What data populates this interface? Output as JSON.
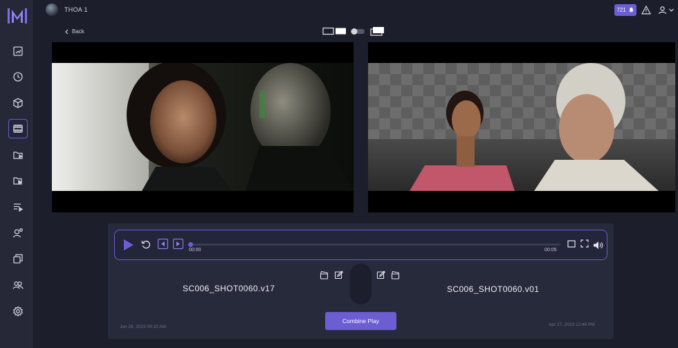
{
  "app": {
    "brand_icon": "m-logo-icon",
    "accent_color": "#6c5dd3"
  },
  "sidebar": {
    "items": [
      {
        "icon": "chart-icon"
      },
      {
        "icon": "clock-icon"
      },
      {
        "icon": "cube-icon"
      },
      {
        "icon": "film-icon",
        "active": true
      },
      {
        "icon": "folder-play-icon"
      },
      {
        "icon": "folder-video-icon"
      },
      {
        "icon": "playlist-icon"
      },
      {
        "icon": "person-settings-icon"
      },
      {
        "icon": "layers-icon"
      },
      {
        "icon": "users-icon"
      },
      {
        "icon": "gear-icon"
      }
    ]
  },
  "header": {
    "project_name": "THOA 1",
    "notification_count": "721"
  },
  "nav": {
    "back_label": "Back"
  },
  "player": {
    "current_time": "00:00",
    "duration": "00:05",
    "progress": 0
  },
  "compare": {
    "left": {
      "shot": "SC006_SHOT0060.v17",
      "date": "Jun 26, 2023 09:10 AM"
    },
    "right": {
      "shot": "SC006_SHOT0060.v01",
      "date": "Apr 27, 2023 12:48 PM"
    }
  },
  "actions": {
    "combine_label": "Combine Play"
  }
}
